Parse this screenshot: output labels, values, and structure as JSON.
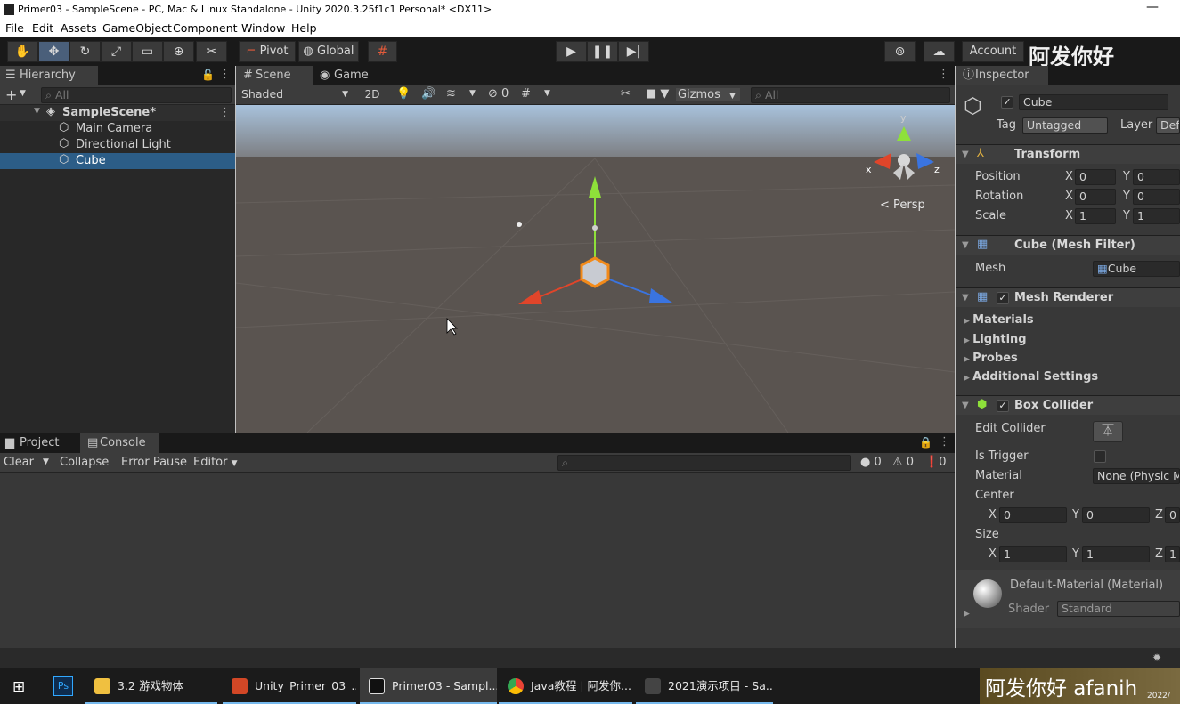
{
  "window": {
    "title": "Primer03 - SampleScene - PC, Mac & Linux Standalone - Unity 2020.3.25f1c1 Personal* <DX11>",
    "minimize": "—"
  },
  "menu": [
    "File",
    "Edit",
    "Assets",
    "GameObject",
    "Component",
    "Window",
    "Help"
  ],
  "toolbar": {
    "pivot": "Pivot",
    "global": "Global",
    "account": "Account",
    "watermark_top": "阿发你好"
  },
  "hierarchy": {
    "tab": "Hierarchy",
    "add": "+",
    "search_placeholder": "All",
    "scene": "SampleScene*",
    "items": [
      "Main Camera",
      "Directional Light",
      "Cube"
    ]
  },
  "scene_view": {
    "tab_scene": "Scene",
    "tab_game": "Game",
    "shading": "Shaded",
    "mode_2d": "2D",
    "hidden_count": "0",
    "gizmos": "Gizmos",
    "search_placeholder": "All",
    "persp": "Persp",
    "axis_x": "x",
    "axis_y": "y",
    "axis_z": "z"
  },
  "console": {
    "tab_project": "Project",
    "tab_console": "Console",
    "clear": "Clear",
    "collapse": "Collapse",
    "error_pause": "Error Pause",
    "editor": "Editor",
    "count_log": "0",
    "count_warn": "0",
    "count_err": "0"
  },
  "inspector": {
    "tab": "Inspector",
    "object_name": "Cube",
    "tag_label": "Tag",
    "tag_value": "Untagged",
    "layer_label": "Layer",
    "layer_value": "Def",
    "transform": {
      "title": "Transform",
      "position_label": "Position",
      "rotation_label": "Rotation",
      "scale_label": "Scale",
      "pos_x": "0",
      "pos_y": "0",
      "rot_x": "0",
      "rot_y": "0",
      "scale_x": "1",
      "scale_y": "1"
    },
    "mesh_filter": {
      "title": "Cube (Mesh Filter)",
      "mesh_label": "Mesh",
      "mesh_value": "Cube"
    },
    "mesh_renderer": {
      "title": "Mesh Renderer",
      "sections": [
        "Materials",
        "Lighting",
        "Probes",
        "Additional Settings"
      ]
    },
    "box_collider": {
      "title": "Box Collider",
      "edit_collider": "Edit Collider",
      "is_trigger": "Is Trigger",
      "material_label": "Material",
      "material_value": "None (Physic M",
      "center_label": "Center",
      "center_x": "0",
      "center_y": "0",
      "center_z": "0",
      "size_label": "Size",
      "size_x": "1",
      "size_y": "1",
      "size_z": "1"
    },
    "material": {
      "name": "Default-Material (Material)",
      "shader_label": "Shader",
      "shader_value": "Standard"
    }
  },
  "taskbar": {
    "items": [
      "3.2 游戏物体",
      "Unity_Primer_03_...",
      "Primer03 - Sampl...",
      "Java教程 | 阿发你...",
      "2021演示项目 - Sa..."
    ],
    "watermark": "阿发你好 afanih",
    "year": "2022/"
  },
  "axis_labels": {
    "x": "X",
    "y": "Y",
    "z": "Z"
  },
  "colors": {
    "x_axis": "#e0452a",
    "y_axis": "#8ee03a",
    "z_axis": "#3a74e0",
    "selection": "#2c5d87"
  }
}
